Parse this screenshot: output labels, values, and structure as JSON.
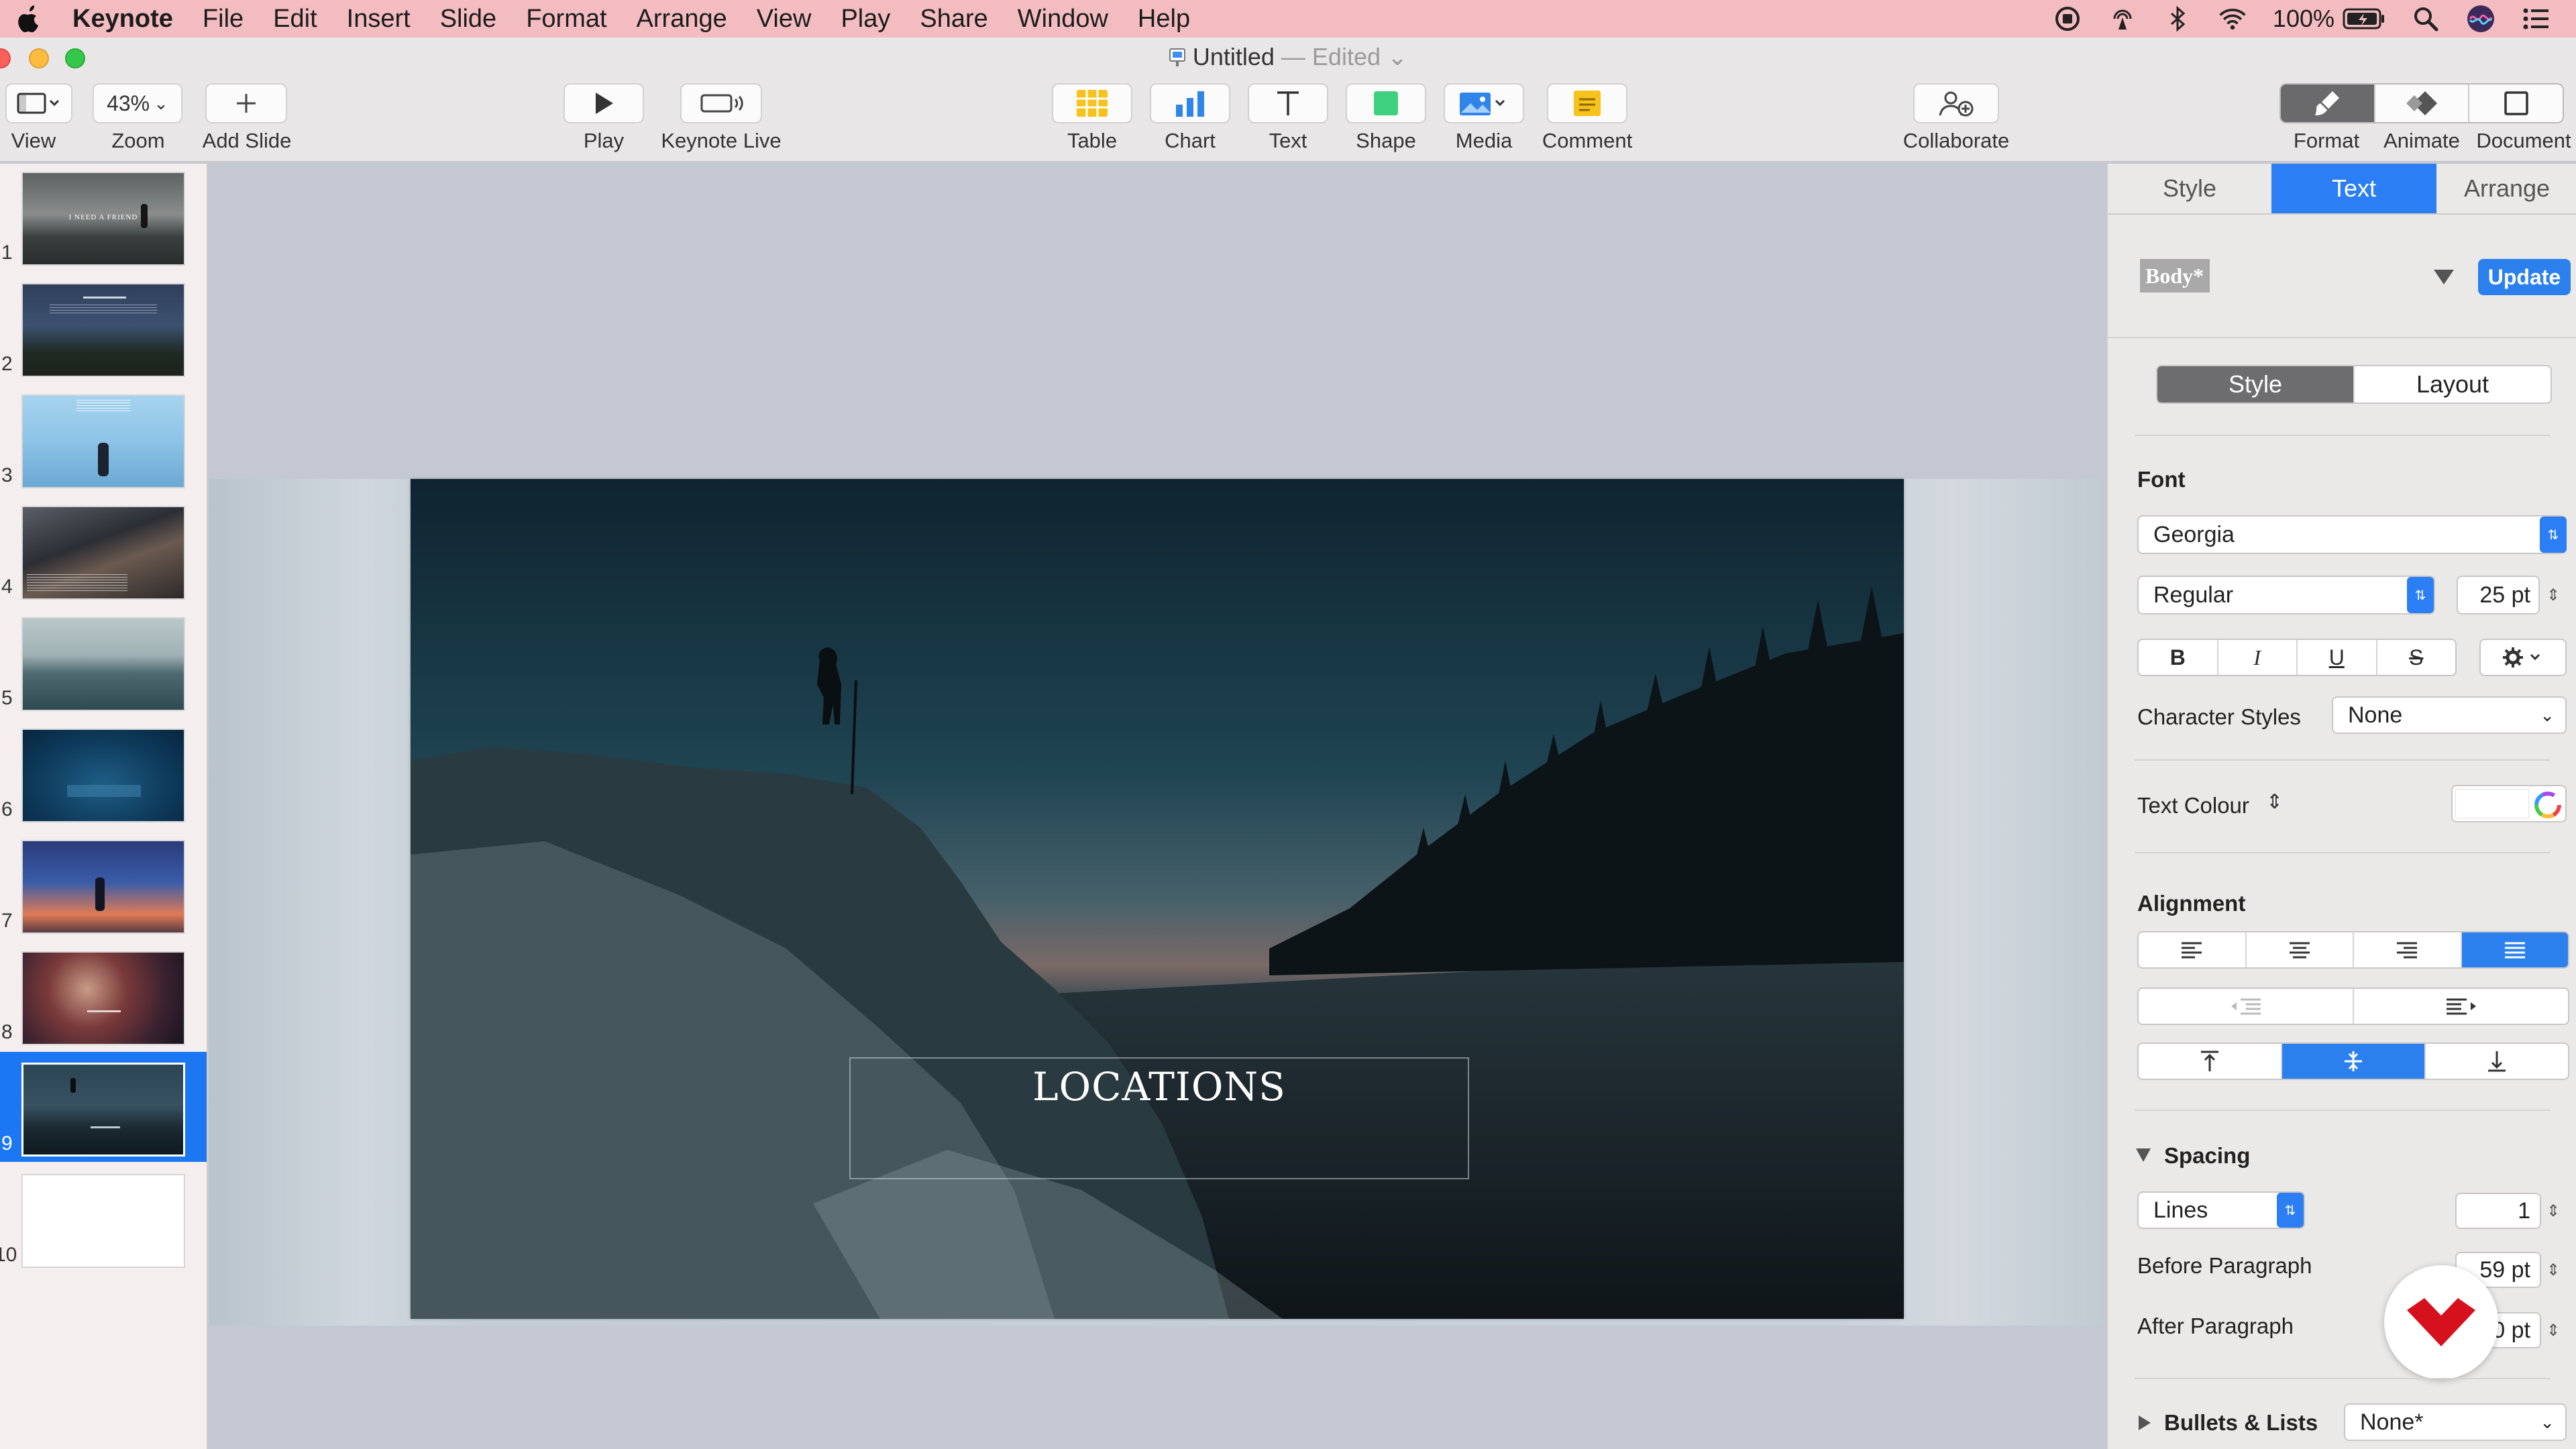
{
  "menubar": {
    "app": "Keynote",
    "items": [
      "File",
      "Edit",
      "Insert",
      "Slide",
      "Format",
      "Arrange",
      "View",
      "Play",
      "Share",
      "Window",
      "Help"
    ],
    "battery": "100%"
  },
  "window": {
    "title": "Untitled",
    "status": "— Edited"
  },
  "toolbar": {
    "view_label": "View",
    "zoom_value": "43%",
    "zoom_label": "Zoom",
    "add_slide_label": "Add Slide",
    "play_label": "Play",
    "keynote_live_label": "Keynote Live",
    "table_label": "Table",
    "chart_label": "Chart",
    "text_label": "Text",
    "shape_label": "Shape",
    "media_label": "Media",
    "comment_label": "Comment",
    "collaborate_label": "Collaborate",
    "format_label": "Format",
    "animate_label": "Animate",
    "document_label": "Document"
  },
  "navigator": {
    "slides": [
      "1",
      "2",
      "3",
      "4",
      "5",
      "6",
      "7",
      "8",
      "9",
      "10"
    ],
    "selected": "9",
    "slide1_caption": "I NEED A FRIEND"
  },
  "slide": {
    "title": "LOCATIONS"
  },
  "inspector": {
    "tabs": [
      "Style",
      "Text",
      "Arrange"
    ],
    "active_tab": "Text",
    "paragraph_style": "Body*",
    "update_label": "Update",
    "subtabs": [
      "Style",
      "Layout"
    ],
    "font_heading": "Font",
    "font_family": "Georgia",
    "font_typeface": "Regular",
    "font_size": "25 pt",
    "bold": "B",
    "italic": "I",
    "underline": "U",
    "strike": "S",
    "char_styles_label": "Character Styles",
    "char_styles_value": "None",
    "text_colour_label": "Text Colour",
    "alignment_heading": "Alignment",
    "spacing_heading": "Spacing",
    "spacing_mode": "Lines",
    "spacing_value": "1",
    "before_paragraph_label": "Before Paragraph",
    "before_paragraph_value": "59 pt",
    "after_paragraph_label": "After Paragraph",
    "after_paragraph_value": "0 pt",
    "bullets_label": "Bullets & Lists",
    "bullets_value": "None*"
  },
  "colors": {
    "accent": "#2b7ef3",
    "menubar": "#f3bcc0",
    "watermark": "#d4111d"
  }
}
